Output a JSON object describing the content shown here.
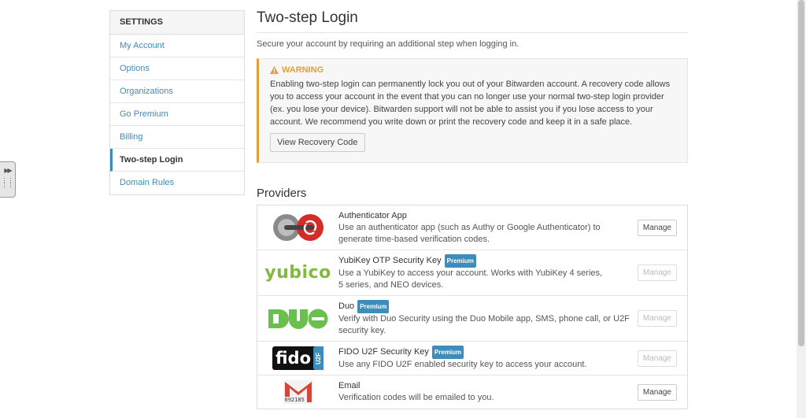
{
  "sidebar": {
    "header": "SETTINGS",
    "items": [
      {
        "label": "My Account"
      },
      {
        "label": "Options"
      },
      {
        "label": "Organizations"
      },
      {
        "label": "Go Premium"
      },
      {
        "label": "Billing"
      },
      {
        "label": "Two-step Login",
        "active": true
      },
      {
        "label": "Domain Rules"
      }
    ]
  },
  "main": {
    "title": "Two-step Login",
    "subtitle": "Secure your account by requiring an additional step when logging in.",
    "warning": {
      "title": "WARNING",
      "text": "Enabling two-step login can permanently lock you out of your Bitwarden account. A recovery code allows you to access your account in the event that you can no longer use your normal two-step login provider (ex. you lose your device). Bitwarden support will not be able to assist you if you lose access to your account. We recommend you write down or print the recovery code and keep it in a safe place.",
      "button": "View Recovery Code",
      "accent_color": "#e0a03a"
    },
    "providers_title": "Providers",
    "providers": [
      {
        "name": "Authenticator App",
        "description": "Use an authenticator app (such as Authy or Google Authenticator) to generate time-based verification codes.",
        "premium": "",
        "button": "Manage",
        "enabled": true
      },
      {
        "name": "YubiKey OTP Security Key",
        "description": "Use a YubiKey to access your account. Works with YubiKey 4 series, 5 series, and NEO devices.",
        "premium": "Premium",
        "button": "Manage",
        "enabled": false,
        "logo_text": "yubico"
      },
      {
        "name": "Duo",
        "description": "Verify with Duo Security using the Duo Mobile app, SMS, phone call, or U2F security key.",
        "premium": "Premium",
        "button": "Manage",
        "enabled": false
      },
      {
        "name": "FIDO U2F Security Key",
        "description": "Use any FIDO U2F enabled security key to access your account.",
        "premium": "Premium",
        "button": "Manage",
        "enabled": false,
        "logo_text": "fido",
        "logo_side_text": "U2F"
      },
      {
        "name": "Email",
        "description": "Verification codes will be emailed to you.",
        "premium": "",
        "button": "Manage",
        "enabled": true,
        "logo_code": "092185"
      }
    ]
  },
  "colors": {
    "link": "#3c8dbc",
    "badge": "#3c8dbc",
    "yubico": "#84b93f",
    "duo": "#6bbf4e",
    "gmail": "#d44638"
  }
}
